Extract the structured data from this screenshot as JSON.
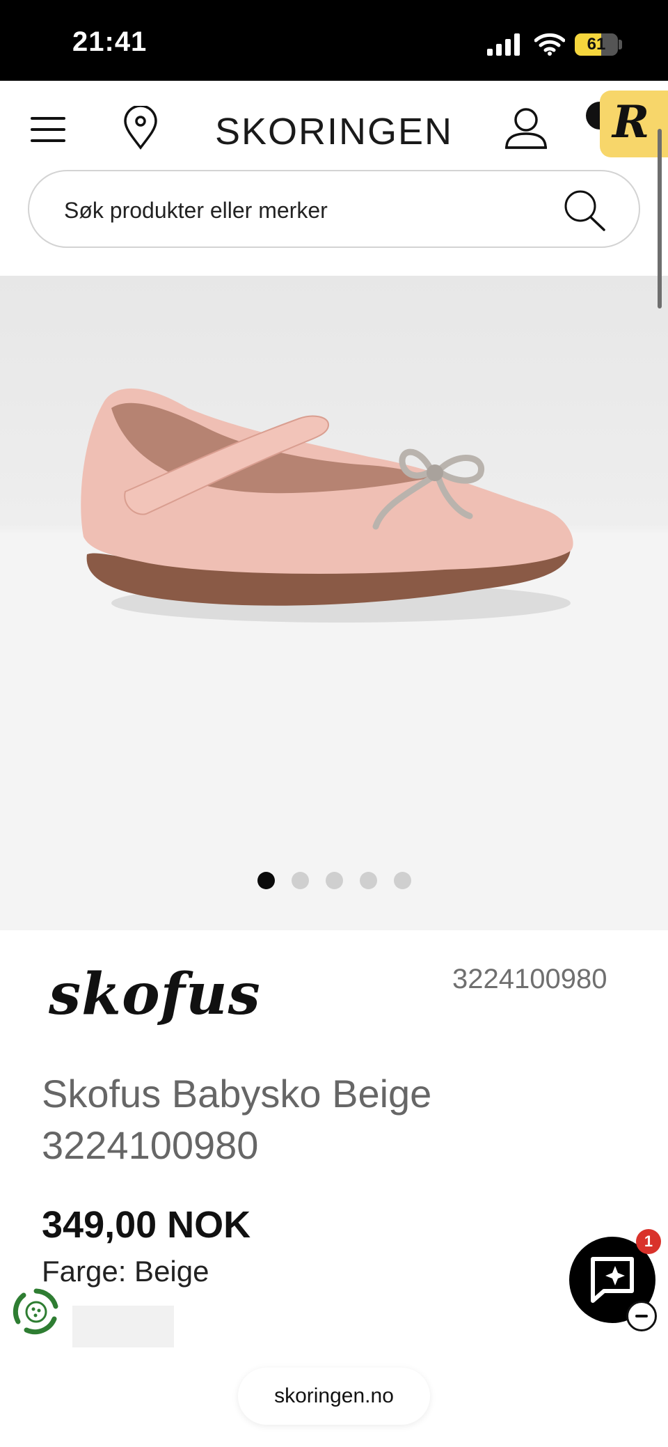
{
  "status_bar": {
    "time": "21:41",
    "battery_level": "61",
    "battery_fraction": 0.61
  },
  "header": {
    "site_title": "SKORINGEN",
    "search_placeholder": "Søk produkter eller merker",
    "badge_letter": "R"
  },
  "gallery": {
    "image_alt": "Pink baby shoe with rhinestone bow",
    "dot_count": 5,
    "active_index": 0
  },
  "product": {
    "brand": "skofus",
    "sku": "3224100980",
    "title": "Skofus Babysko Beige 3224100980",
    "price": "349,00 NOK",
    "color_label": "Farge: Beige"
  },
  "chat": {
    "unread": "1"
  },
  "footer": {
    "url": "skoringen.no"
  },
  "colors": {
    "accent_badge": "#f7d66a",
    "chat_badge": "#d9322b",
    "eco_green": "#2e7d32"
  }
}
